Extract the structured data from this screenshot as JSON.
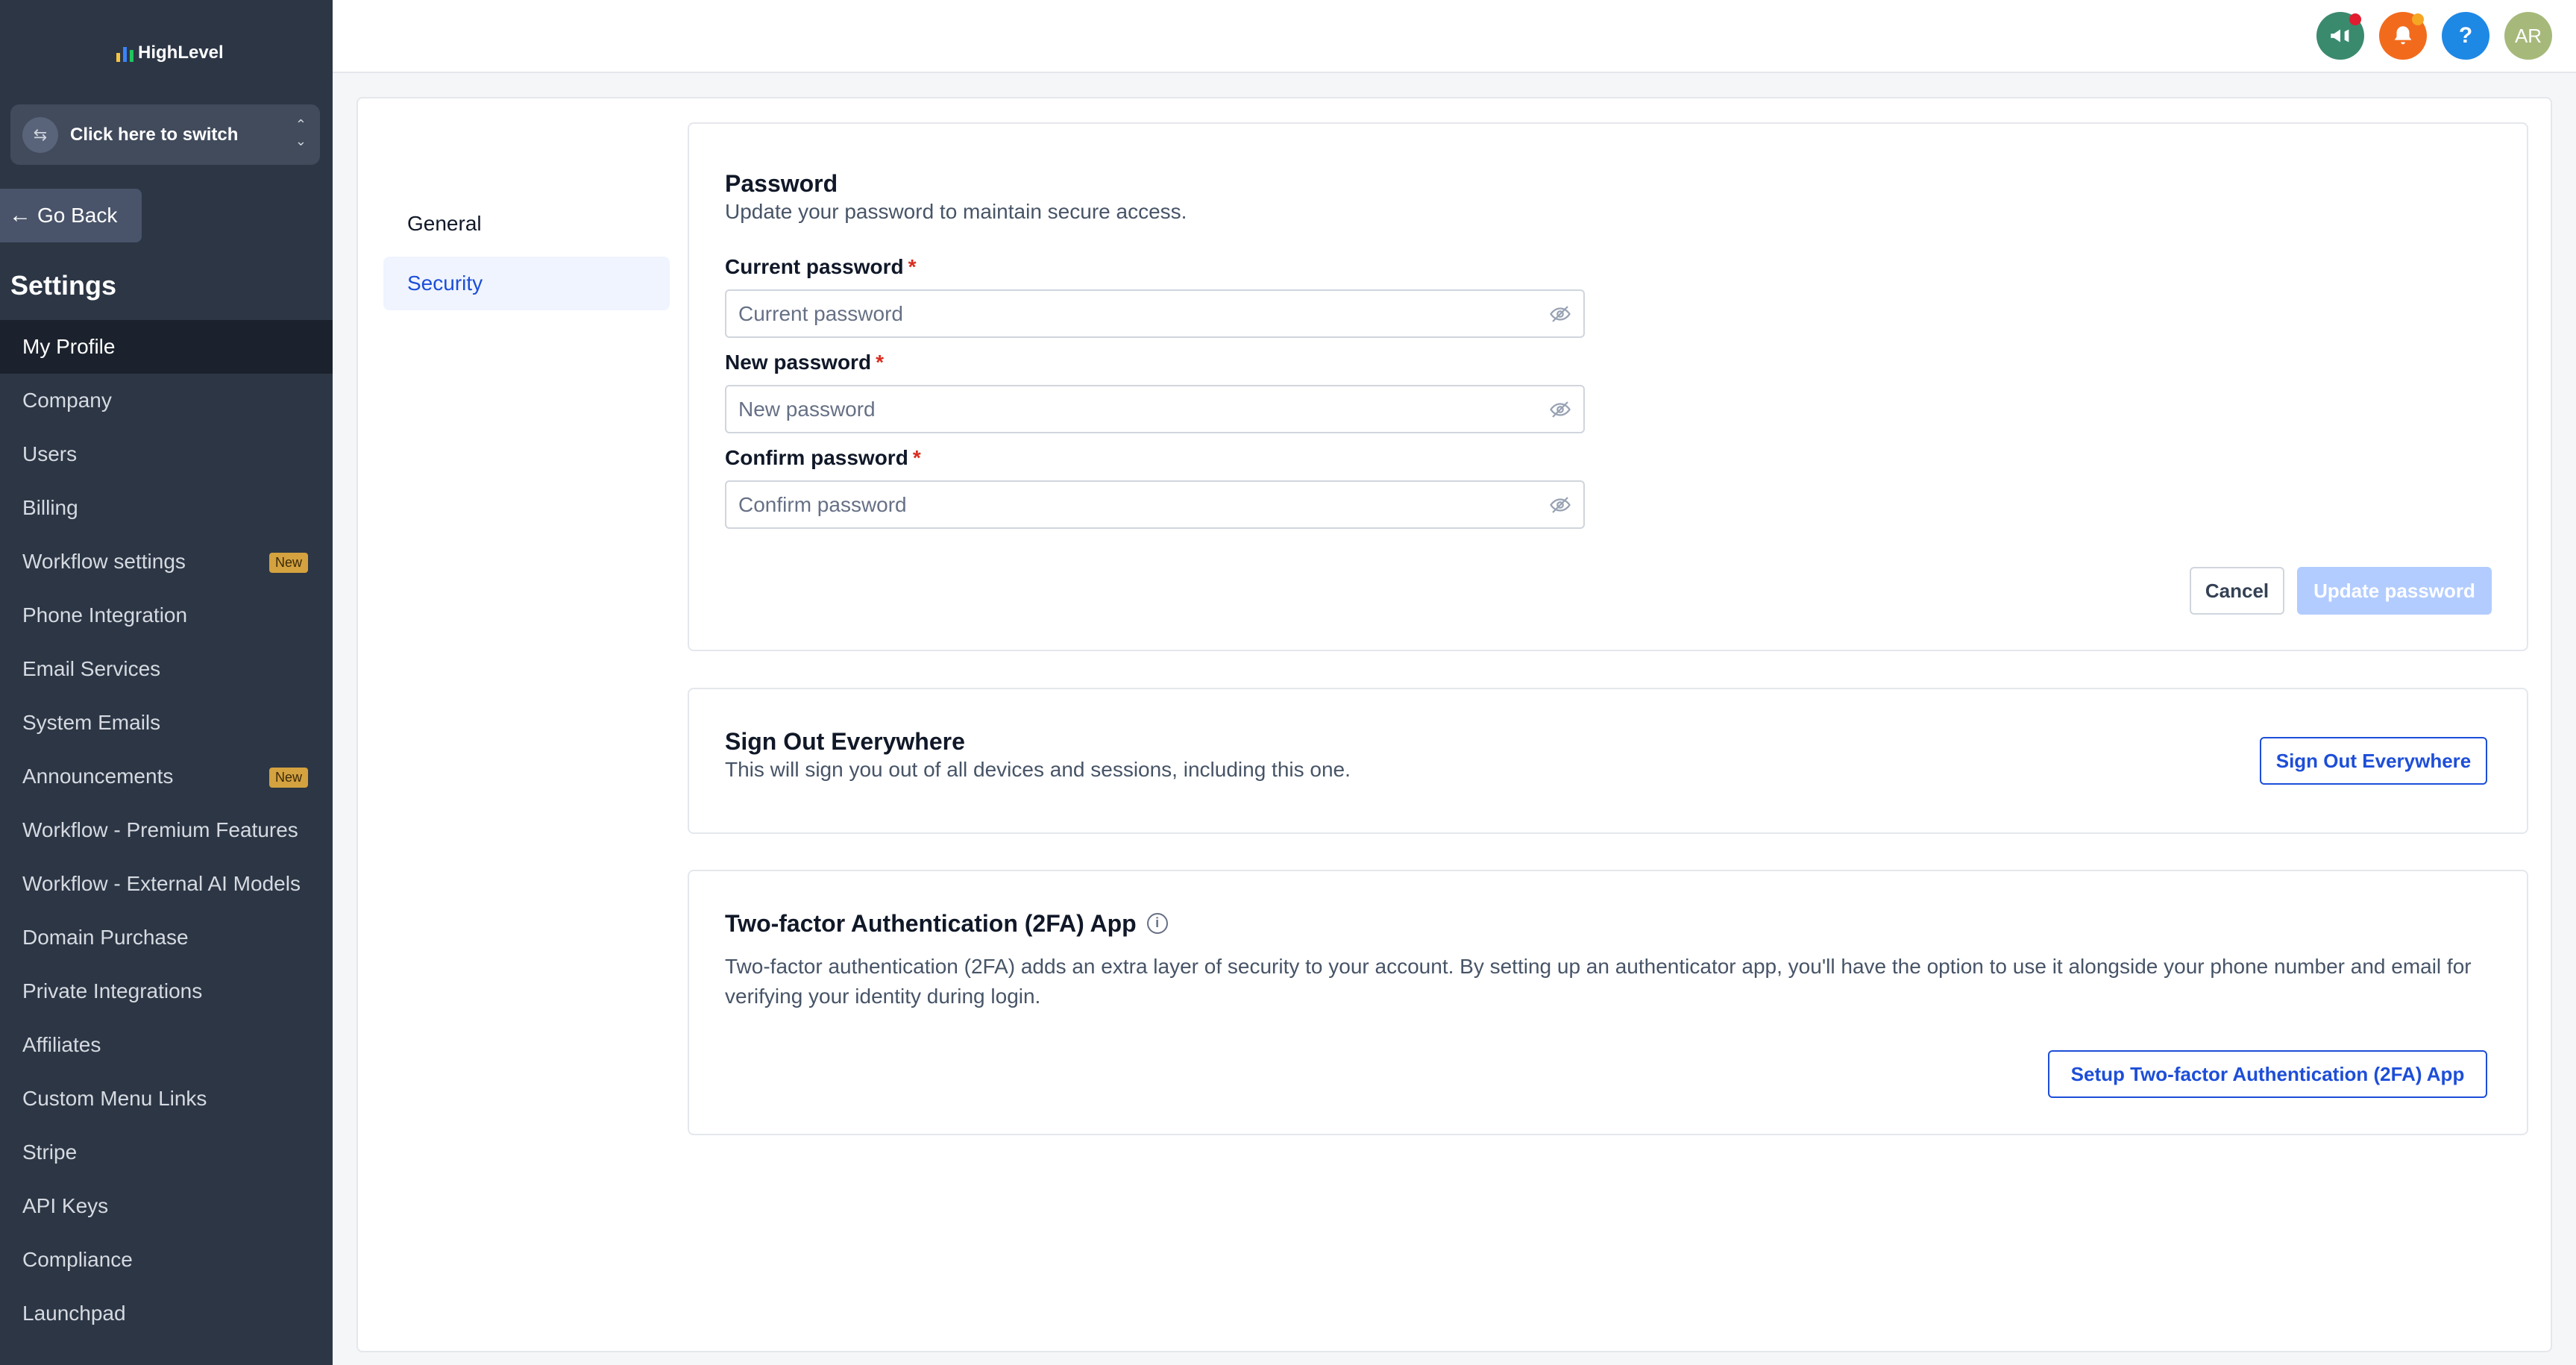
{
  "app": {
    "brand": "HighLevel"
  },
  "colors": {
    "sidebar_bg": "#2c3645",
    "accent_blue": "#1d4ed8",
    "badge_gold": "#d4a23f",
    "required_red": "#d92d20"
  },
  "sidebar": {
    "switcher_label": "Click here to switch",
    "go_back_label": "Go Back",
    "title": "Settings",
    "items": [
      {
        "label": "My Profile",
        "active": true
      },
      {
        "label": "Company"
      },
      {
        "label": "Users"
      },
      {
        "label": "Billing"
      },
      {
        "label": "Workflow settings",
        "badge": "New"
      },
      {
        "label": "Phone Integration"
      },
      {
        "label": "Email Services"
      },
      {
        "label": "System Emails"
      },
      {
        "label": "Announcements",
        "badge": "New"
      },
      {
        "label": "Workflow - Premium Features"
      },
      {
        "label": "Workflow - External AI Models"
      },
      {
        "label": "Domain Purchase"
      },
      {
        "label": "Private Integrations"
      },
      {
        "label": "Affiliates"
      },
      {
        "label": "Custom Menu Links"
      },
      {
        "label": "Stripe"
      },
      {
        "label": "API Keys"
      },
      {
        "label": "Compliance"
      },
      {
        "label": "Launchpad"
      }
    ]
  },
  "header": {
    "icons": [
      "megaphone-icon",
      "bell-icon",
      "help-icon",
      "avatar"
    ],
    "help_label": "?",
    "avatar_initials": "AR"
  },
  "subnav": {
    "items": [
      {
        "label": "General"
      },
      {
        "label": "Security",
        "active": true
      }
    ]
  },
  "password": {
    "title": "Password",
    "description": "Update your password to maintain secure access.",
    "current_label": "Current password",
    "current_placeholder": "Current password",
    "new_label": "New password",
    "new_placeholder": "New password",
    "confirm_label": "Confirm password",
    "confirm_placeholder": "Confirm password",
    "required_mark": "*",
    "cancel_label": "Cancel",
    "update_label": "Update password"
  },
  "signout": {
    "title": "Sign Out Everywhere",
    "description": "This will sign you out of all devices and sessions, including this one.",
    "button_label": "Sign Out Everywhere"
  },
  "twofa": {
    "title": "Two-factor Authentication (2FA) App",
    "info_glyph": "i",
    "description": "Two-factor authentication (2FA) adds an extra layer of security to your account. By setting up an authenticator app, you'll have the option to use it alongside your phone number and email for verifying your identity during login.",
    "button_label": "Setup Two-factor Authentication (2FA) App"
  }
}
